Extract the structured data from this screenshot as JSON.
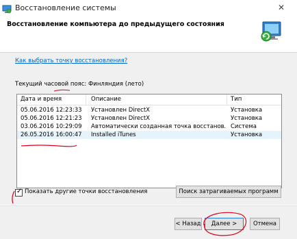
{
  "window": {
    "title": "Восстановление системы",
    "close_glyph": "✕"
  },
  "header": {
    "title": "Восстановление компьютера до предыдущего состояния"
  },
  "help_link": "Как выбрать точку восстановления?",
  "timezone_label": "Текущий часовой пояс: Финляндия (лето)",
  "table": {
    "headers": [
      "Дата и время",
      "Описание",
      "Тип"
    ],
    "rows": [
      {
        "date": "05.06.2016 12:23:33",
        "desc": "Установлен DirectX",
        "type": "Установка"
      },
      {
        "date": "05.06.2016 12:21:23",
        "desc": "Установлен DirectX",
        "type": "Установка"
      },
      {
        "date": "03.06.2016 10:29:09",
        "desc": "Автоматически созданная точка восстановле...",
        "type": "Система"
      },
      {
        "date": "26.05.2016 16:00:47",
        "desc": "Installed iTunes",
        "type": "Установка"
      }
    ]
  },
  "show_other": {
    "label": "Показать другие точки восстановления",
    "checked_glyph": "✓"
  },
  "buttons": {
    "search": "Поиск затрагиваемых программ",
    "back": "< Назад",
    "next": "Далее >",
    "cancel": "Отмена"
  },
  "colors": {
    "accent": "#0066cc",
    "annotation": "#e0001a",
    "selected_row": "#e5f3fb"
  }
}
